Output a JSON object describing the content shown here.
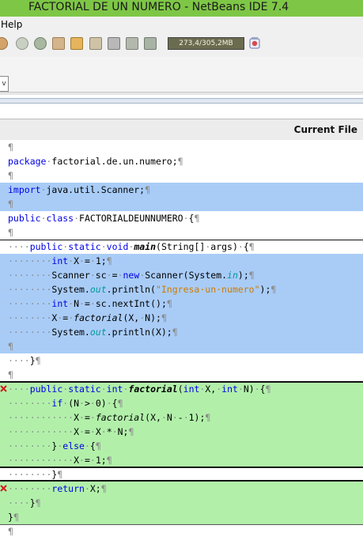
{
  "window": {
    "title": "FACTORIAL DE UN NUMERO - NetBeans IDE 7.4"
  },
  "menu": {
    "help": "Help"
  },
  "toolbar": {
    "memory": "273,4/305,2MB",
    "icons": [
      "stop-icon",
      "run-icon",
      "debug-icon",
      "step-icon",
      "download-icon",
      "upload-icon",
      "cut-icon",
      "profile-icon",
      "tree-icon",
      "camera-icon"
    ],
    "gc_icon": "garbage-collect-icon"
  },
  "combo": {
    "arrow": "v"
  },
  "header": {
    "current_file": "Current File"
  },
  "editor": {
    "pilcrow": "¶",
    "lines": [
      "package factorial.de.un.numero;",
      "import java.util.Scanner;",
      "public class FACTORIALDEUNNUMERO {",
      "public static void main(String[] args) {",
      "int X = 1;",
      "Scanner sc = new Scanner(System.in);",
      "System.out.println(\"Ingresa un numero\");",
      "int N = sc.nextInt();",
      "X = factorial(X, N);",
      "System.out.println(X);",
      "}",
      "public static int factorial(int X, int N) {",
      "if (N > 0) {",
      "X = factorial(X, N - 1);",
      "X = X * N;",
      "} else {",
      "X = 1;",
      "}",
      "return X;",
      "}",
      "}"
    ],
    "error_marker": "error-x-icon"
  },
  "colors": {
    "title_bar": "#7ec646",
    "blue_highlight": "#a9ccf7",
    "green_highlight": "#b2f0aa",
    "keyword": "#0000e6",
    "string": "#ce7b00",
    "field": "#009a9a"
  }
}
